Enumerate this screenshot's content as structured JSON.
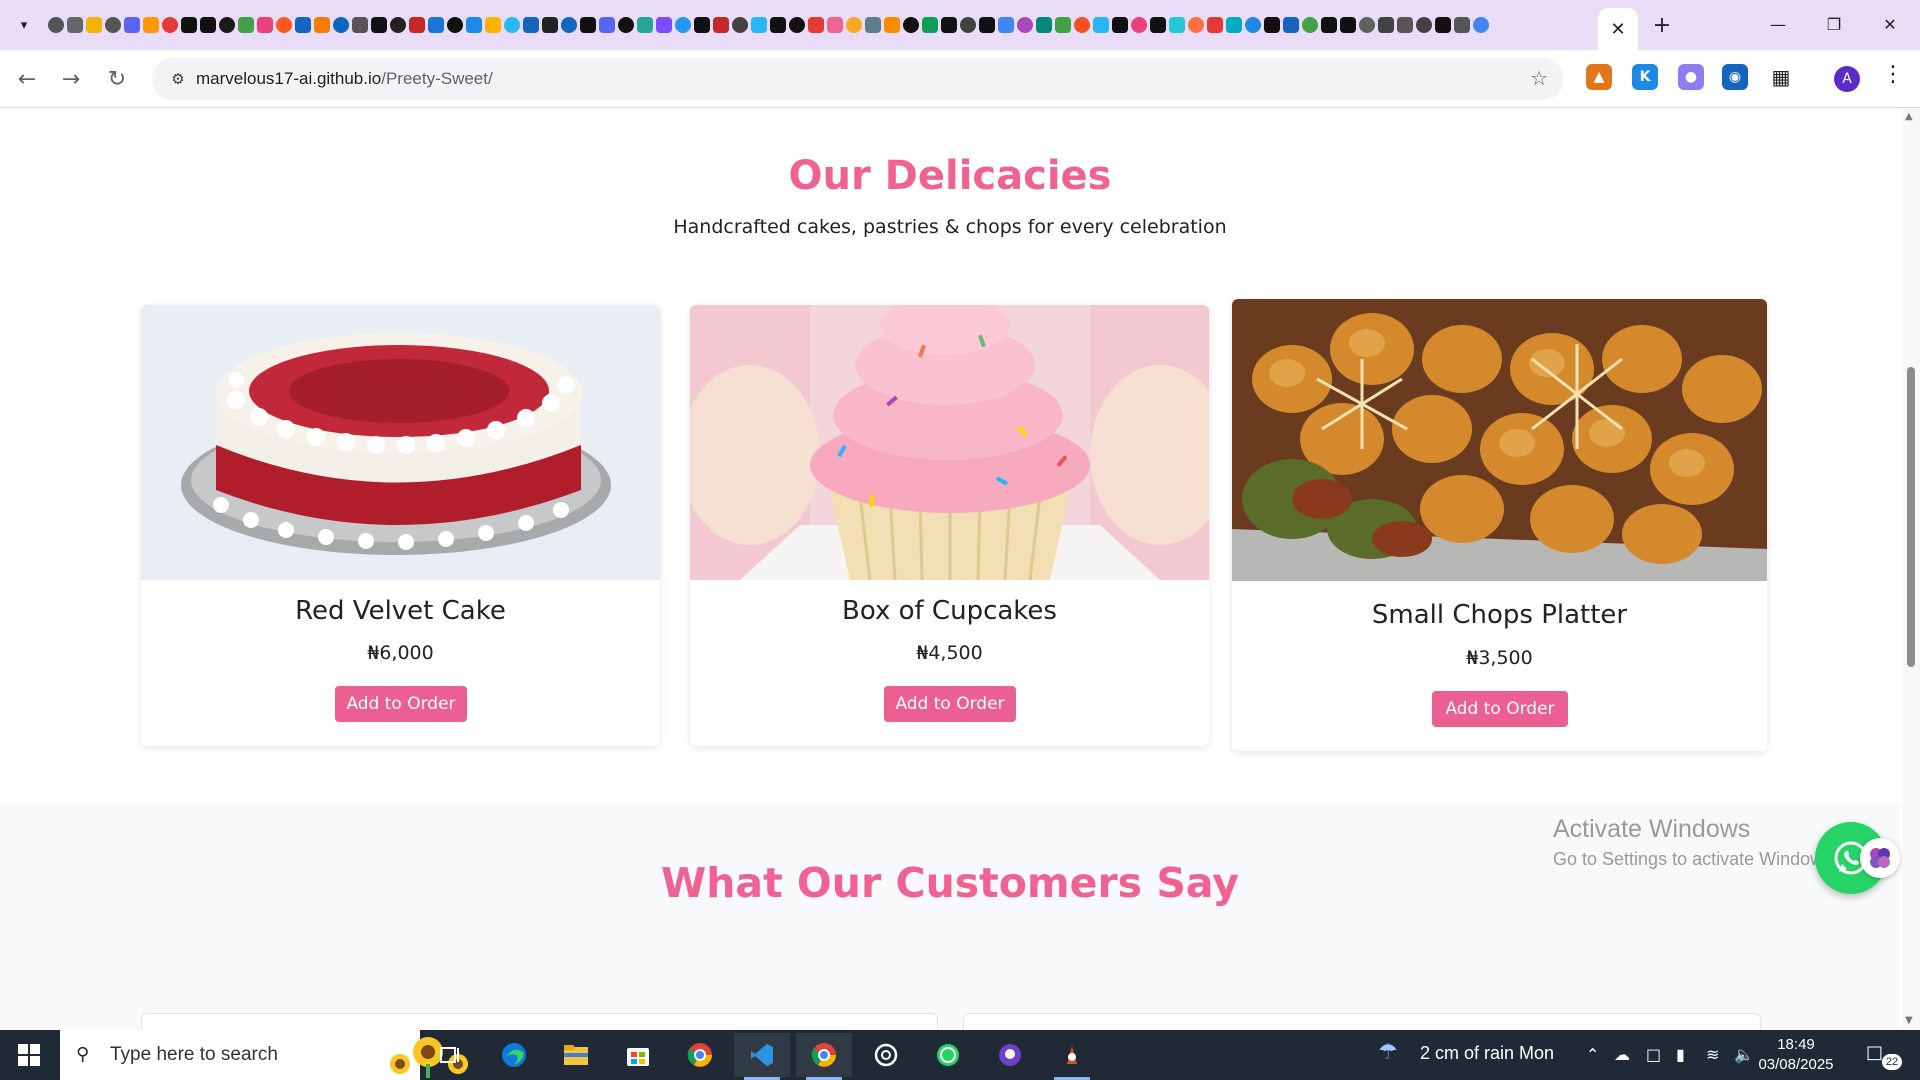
{
  "browser": {
    "url_host": "marvelous17-ai.github.io",
    "url_path": "/Preety-Sweet/",
    "tab_close_glyph": "✕",
    "new_tab_glyph": "+",
    "pinned_favicon_colors": [
      "#555555",
      "#666666",
      "#f5b400",
      "#555555",
      "#5865f2",
      "#ff9800",
      "#e53935",
      "#111111",
      "#111111",
      "#1a1a1a",
      "#43a047",
      "#ec407a",
      "#ff5722",
      "#1565c0",
      "#f57c00",
      "#0a66c2",
      "#555555",
      "#111111",
      "#222222",
      "#c62828",
      "#1976d2",
      "#111111",
      "#1e88e5",
      "#ffb300",
      "#29b6f6",
      "#1565c0",
      "#222222",
      "#1565c0",
      "#111111",
      "#5865f2",
      "#111111",
      "#26a69a",
      "#7c4dff",
      "#2196f3",
      "#111111",
      "#c62828",
      "#424242",
      "#29b6f6",
      "#111111",
      "#111111",
      "#e53935",
      "#f06292",
      "#f9a825",
      "#607d8b",
      "#fb8c00",
      "#111111",
      "#0f9d58",
      "#111111",
      "#424242",
      "#111111",
      "#4285f4",
      "#ab47bc",
      "#00897b",
      "#43a047",
      "#f4511e",
      "#29b6f6",
      "#111111",
      "#ec407a",
      "#111111",
      "#26c6da",
      "#ff7043",
      "#e53935",
      "#00acc1",
      "#1e88e5",
      "#111111",
      "#1565c0",
      "#43a047",
      "#111111",
      "#111111",
      "#616161",
      "#424242",
      "#555555",
      "#424242",
      "#111111",
      "#555555",
      "#4285f4"
    ]
  },
  "page": {
    "delicacies_title": "Our Delicacies",
    "delicacies_subtitle": "Handcrafted cakes, pastries & chops for every celebration",
    "products": [
      {
        "name": "Red Velvet Cake",
        "price": "₦6,000",
        "button": "Add to Order"
      },
      {
        "name": "Box of Cupcakes",
        "price": "₦4,500",
        "button": "Add to Order"
      },
      {
        "name": "Small Chops Platter",
        "price": "₦3,500",
        "button": "Add to Order"
      }
    ],
    "testimonials_title": "What Our Customers Say"
  },
  "overlay": {
    "watermark_line1": "Activate Windows",
    "watermark_line2": "Go to Settings to activate Windows."
  },
  "taskbar": {
    "search_placeholder": "Type here to search",
    "weather_text": "2 cm of rain  Mon",
    "time": "18:49",
    "date": "03/08/2025",
    "notification_count": "22"
  },
  "colors": {
    "accent_pink": "#f06292",
    "button_pink": "#ec5f91",
    "tabbar_bg": "#e9dcf7",
    "taskbar_bg": "#1f2a36"
  }
}
